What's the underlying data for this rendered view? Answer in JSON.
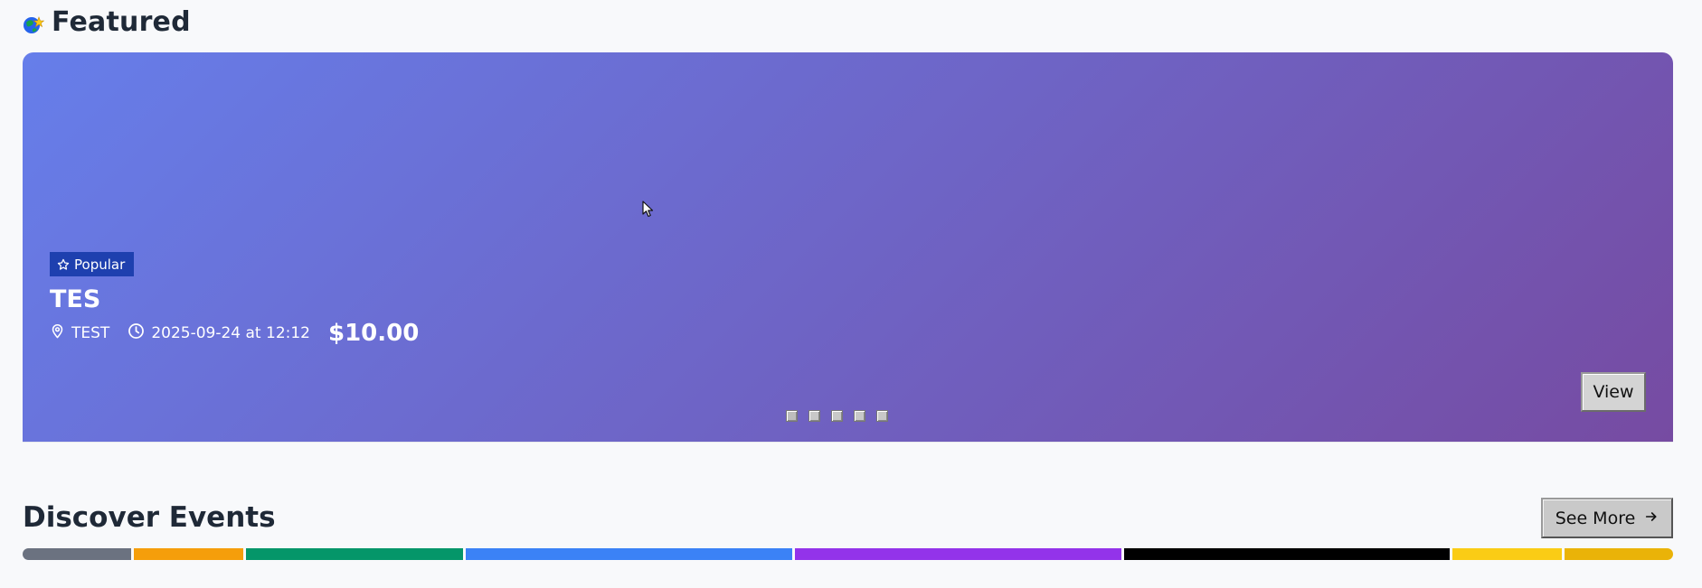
{
  "featured": {
    "title": "Featured",
    "icon": "globe-star-icon"
  },
  "carousel": {
    "gradient_start": "#667eea",
    "gradient_end": "#764ba2",
    "badge": {
      "icon": "star-icon",
      "label": "Popular",
      "color": "#1e40af"
    },
    "event": {
      "title": "TES",
      "location_icon": "map-pin-icon",
      "location": "TEST",
      "time_icon": "clock-icon",
      "datetime": "2025-09-24 at 12:12",
      "price": "$10.00"
    },
    "view_label": "View",
    "slides_count": 5,
    "active_slide": 0
  },
  "discover": {
    "title": "Discover Events",
    "see_more_label": "See More",
    "see_more_icon": "arrow-right-icon",
    "categories": [
      {
        "color": "#6b7280",
        "weight": 1
      },
      {
        "color": "#f59e0b",
        "weight": 1
      },
      {
        "color": "#059669",
        "weight": 2
      },
      {
        "color": "#3b82f6",
        "weight": 3
      },
      {
        "color": "#9333ea",
        "weight": 3
      },
      {
        "color": "#000000",
        "weight": 3
      },
      {
        "color": "#facc15",
        "weight": 1
      },
      {
        "color": "#eab308",
        "weight": 1
      }
    ]
  }
}
